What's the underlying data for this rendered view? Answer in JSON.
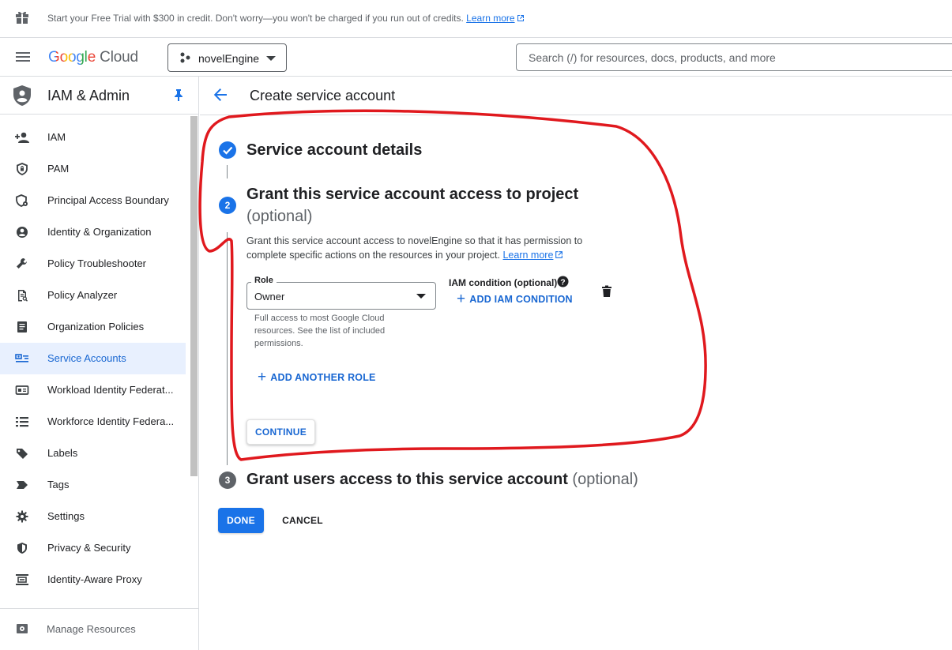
{
  "banner": {
    "text": "Start your Free Trial with $300 in credit. Don't worry—you won't be charged if you run out of credits.",
    "link": "Learn more"
  },
  "topbar": {
    "logo_google": "Google",
    "logo_cloud": "Cloud",
    "project": "novelEngine",
    "search_placeholder": "Search (/) for resources, docs, products, and more"
  },
  "sidebar": {
    "title": "IAM & Admin",
    "items": [
      {
        "label": "IAM",
        "icon": "person-add-icon"
      },
      {
        "label": "PAM",
        "icon": "shield-lock-icon"
      },
      {
        "label": "Principal Access Boundary",
        "icon": "shield-gear-icon"
      },
      {
        "label": "Identity & Organization",
        "icon": "account-circle-icon"
      },
      {
        "label": "Policy Troubleshooter",
        "icon": "wrench-icon"
      },
      {
        "label": "Policy Analyzer",
        "icon": "document-search-icon"
      },
      {
        "label": "Organization Policies",
        "icon": "list-document-icon"
      },
      {
        "label": "Service Accounts",
        "icon": "service-account-icon",
        "active": true
      },
      {
        "label": "Workload Identity Federat...",
        "icon": "id-card-icon"
      },
      {
        "label": "Workforce Identity Federa...",
        "icon": "list-icon"
      },
      {
        "label": "Labels",
        "icon": "label-icon"
      },
      {
        "label": "Tags",
        "icon": "tag-icon"
      },
      {
        "label": "Settings",
        "icon": "gear-icon"
      },
      {
        "label": "Privacy & Security",
        "icon": "shield-icon"
      },
      {
        "label": "Identity-Aware Proxy",
        "icon": "proxy-icon"
      }
    ],
    "footer": "Manage Resources"
  },
  "main": {
    "page_title": "Create service account",
    "step1_title": "Service account details",
    "step2_title": "Grant this service account access to project",
    "step2_optional": "(optional)",
    "step2_number": "2",
    "step2_desc": "Grant this service account access to novelEngine so that it has permission to complete specific actions on the resources in your project.",
    "step2_desc_link": "Learn more",
    "role_label": "Role",
    "role_value": "Owner",
    "role_help": "Full access to most Google Cloud resources. See the list of included permissions.",
    "iam_condition_label": "IAM condition (optional)",
    "add_iam_condition": "ADD IAM CONDITION",
    "add_another_role": "ADD ANOTHER ROLE",
    "continue": "CONTINUE",
    "step3_number": "3",
    "step3_title": "Grant users access to this service account",
    "step3_optional": "(optional)",
    "done": "DONE",
    "cancel": "CANCEL"
  },
  "colors": {
    "accent": "#1a73e8",
    "active_bg": "#e8f0fe",
    "annotation": "#e0191e",
    "step3_badge": "#5f6368"
  }
}
